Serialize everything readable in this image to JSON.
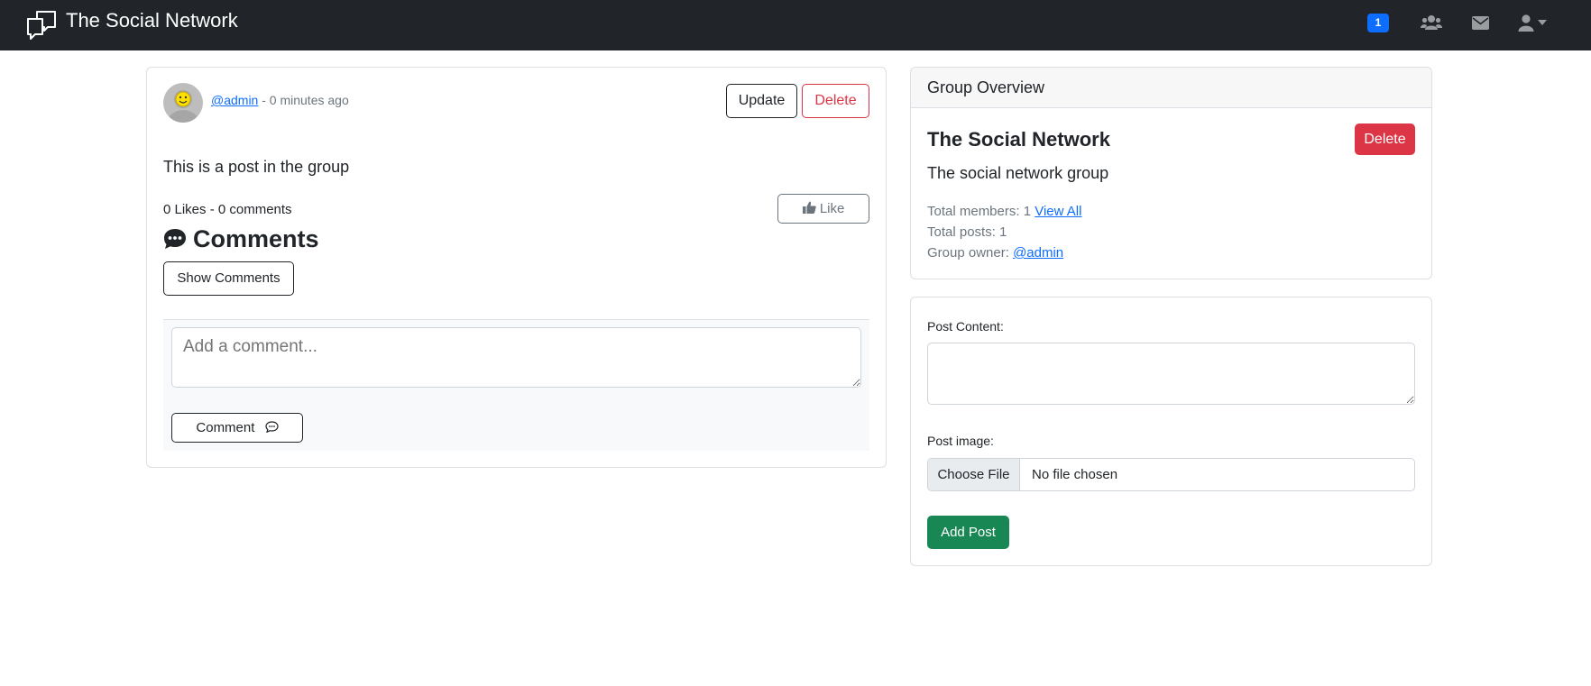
{
  "navbar": {
    "brand_title": "The Social Network",
    "notification_count": "1",
    "icons": [
      "chat-bubbles-icon",
      "users-icon",
      "envelope-icon",
      "user-icon",
      "caret-down-icon"
    ]
  },
  "post": {
    "author": "@admin",
    "time_ago": " - 0 minutes ago",
    "update_label": "Update",
    "delete_label": "Delete",
    "content": "This is a post in the group",
    "stats": "0 Likes - 0 comments",
    "like_label": "Like",
    "comments_heading": "Comments",
    "show_comments_label": "Show Comments",
    "comment_placeholder": "Add a comment...",
    "comment_button_label": "Comment"
  },
  "group": {
    "header": "Group Overview",
    "name": "The Social Network",
    "delete_label": "Delete",
    "description": "The social network group",
    "members_label": "Total members: 1",
    "view_all_label": "View All",
    "posts_label": "Total posts: 1",
    "owner_label": "Group owner:",
    "owner": "@admin"
  },
  "new_post": {
    "content_label": "Post Content:",
    "content_value": "",
    "image_label": "Post image:",
    "choose_file_label": "Choose File",
    "no_file_label": "No file chosen",
    "submit_label": "Add Post"
  },
  "colors": {
    "navbar": "#212529",
    "primary": "#0d6efd",
    "danger": "#dc3545",
    "success": "#198754"
  }
}
